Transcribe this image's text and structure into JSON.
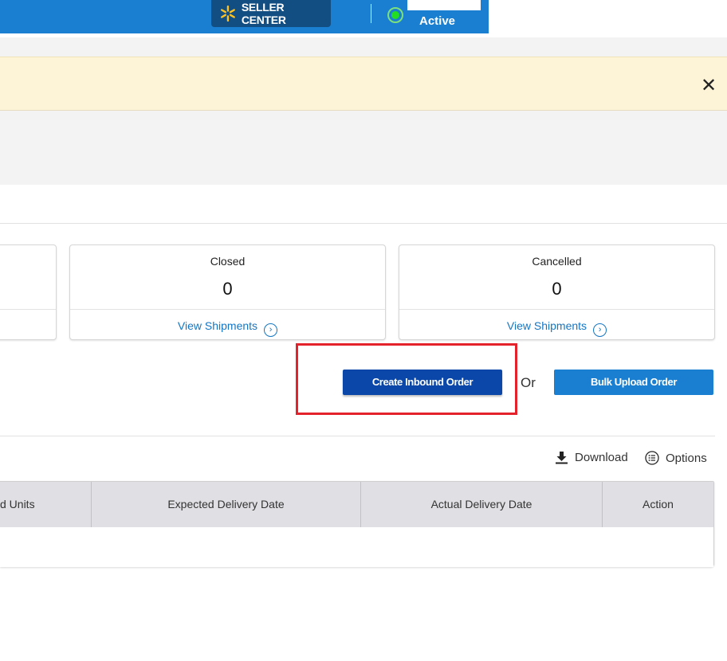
{
  "header": {
    "brand_label": "SELLER CENTER",
    "status_label": "Active",
    "colors": {
      "bar": "#1a7fd0",
      "brand_bg": "#124e82",
      "status": "#22dd22",
      "spark": "#ffc220"
    }
  },
  "notice": {
    "close_icon": "close-icon"
  },
  "summary_cards": [
    {
      "title": "Closed",
      "value": "0",
      "link_label": "View Shipments"
    },
    {
      "title": "Cancelled",
      "value": "0",
      "link_label": "View Shipments"
    }
  ],
  "actions": {
    "create_label": "Create Inbound Order",
    "or_label": "Or",
    "bulk_label": "Bulk Upload Order"
  },
  "table_tools": {
    "download_label": "Download",
    "options_label": "Options"
  },
  "table": {
    "columns": [
      "d Units",
      "Expected Delivery Date",
      "Actual Delivery Date",
      "Action"
    ]
  }
}
